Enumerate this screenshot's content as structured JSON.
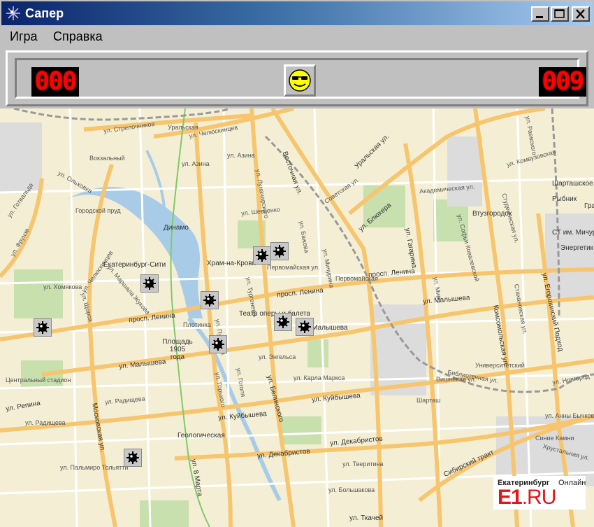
{
  "window": {
    "title": "Сапер"
  },
  "menu": {
    "items": [
      "Игра",
      "Справка"
    ]
  },
  "game": {
    "mines_counter": "000",
    "timer": "009",
    "face": "smiley-sunglasses"
  },
  "colors": {
    "titlebar_start": "#0a246a",
    "titlebar_end": "#a6caf0",
    "window": "#c0c0c0",
    "digits": "#ff0000",
    "map_bg": "#f4efd4",
    "roads": "#f7c56e",
    "water": "#a8cce8",
    "park": "#c8dfae",
    "brand_red": "#e3141a"
  },
  "map": {
    "labels": [
      "ул. Стрелочников",
      "ул. Челюскинцев",
      "Уральская",
      "Вокзальный",
      "ул. Азина",
      "ул. Азина",
      "ул. Готвальда",
      "ул. Ольховка",
      "ул. Челюскинцев",
      "Городской пруд",
      "Динамо",
      "ул. Шевченко",
      "Храм-на-Крови",
      "Первомайская ул.",
      "Екатеринбург-Сити",
      "ул. Хомякова",
      "ул. Маршала Жукова",
      "просп. Ленина",
      "просп. Ленина",
      "просп. Ленина",
      "Первомайская",
      "Театр оперы и балета",
      "Плотинка",
      "Площадь 1905 года",
      "ул. Малышева",
      "ул. Малышева",
      "ул. Малышева",
      "ул. Энгельса",
      "ул. Карла Маркса",
      "Центральный стадион",
      "ул. Репина",
      "ул. Радищева",
      "ул. Радищева",
      "ул. Куйбышева",
      "ул. Куйбышева",
      "Геологическая",
      "ул. Декабристов",
      "ул. Декабристов",
      "ул. Пальмиро Тольятти",
      "ул. Большакова",
      "ул. Ткачей",
      "ул. Тверитина",
      "ул. 8 Марта",
      "Московская ул.",
      "ул. Белинского",
      "Восточная ул.",
      "Уральская ул.",
      "Советская ул.",
      "ул. Блюхера",
      "Академическая ул.",
      "Втузгородок",
      "ул. Гагарина",
      "ул. Мира",
      "Комсомольская ул.",
      "Университетский",
      "Библиотечная ул.",
      "Шарташ",
      "Шарташское",
      "Рыбник",
      "Гра",
      "СТ им. Мичурина",
      "Энергетик",
      "ул. Егоршинский Подход",
      "Сибирский тракт",
      "Синие Камни",
      "Хрустальная ул.",
      "ул. Анны Бычковой",
      "ул. Новгород",
      "ул. Комвузовская",
      "ул. Раевского",
      "Студенческая ул.",
      "Стахановская ул.",
      "ул. Софьи Ковалевской",
      "Вишнёвая ул.",
      "ул. Фрунзе",
      "ул. Щорса",
      "ул. Горького",
      "ул. Гоголя",
      "ул. Бажова",
      "ул. Мичурина",
      "ул. Луначарского",
      "ул. Тургенева",
      "ул. Пушкина"
    ]
  },
  "mines": [
    {
      "row": "a"
    },
    {
      "row": "b"
    },
    {
      "row": "c"
    },
    {
      "row": "d"
    },
    {
      "row": "e"
    },
    {
      "row": "f"
    },
    {
      "row": "g"
    },
    {
      "row": "h"
    },
    {
      "row": "i"
    }
  ],
  "brand": {
    "line1a": "Екатеринбург",
    "line1b": "Онлайн",
    "e1": "E1",
    "ru": ".RU"
  }
}
